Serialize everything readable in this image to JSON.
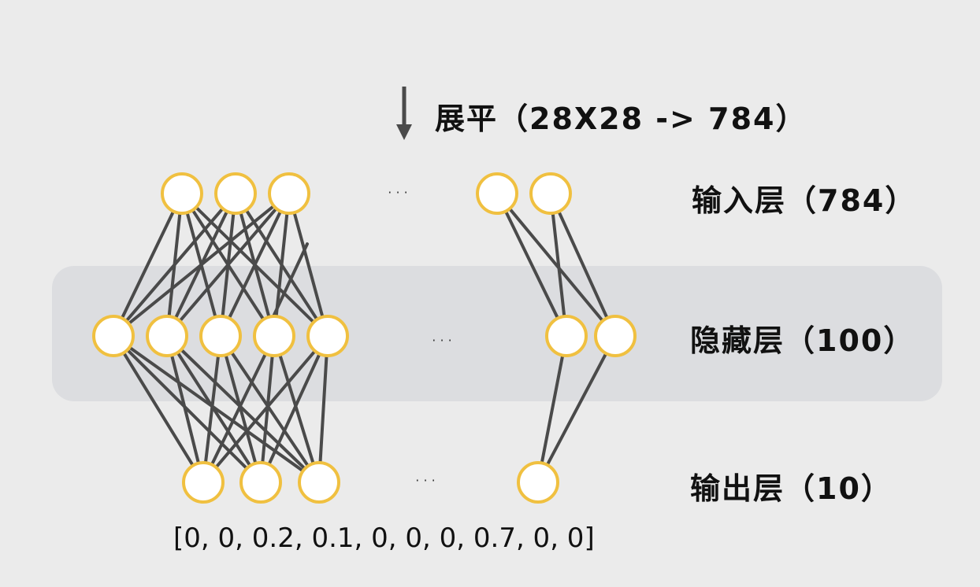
{
  "labels": {
    "flatten": "展平（28X28 -> 784）",
    "input_layer": "输入层（784）",
    "hidden_layer": "隐藏层（100）",
    "output_layer": "输出层（10）"
  },
  "ellipsis": "· · ·",
  "output_vector": "[0, 0, 0.2, 0.1, 0, 0, 0, 0.7, 0, 0]",
  "colors": {
    "background": "#ebebeb",
    "hidden_band": "#dcdde0",
    "node_fill": "#ffffff",
    "node_stroke": "#f0c040",
    "edge": "#4a4a4a",
    "arrow": "#4a4a4a"
  }
}
